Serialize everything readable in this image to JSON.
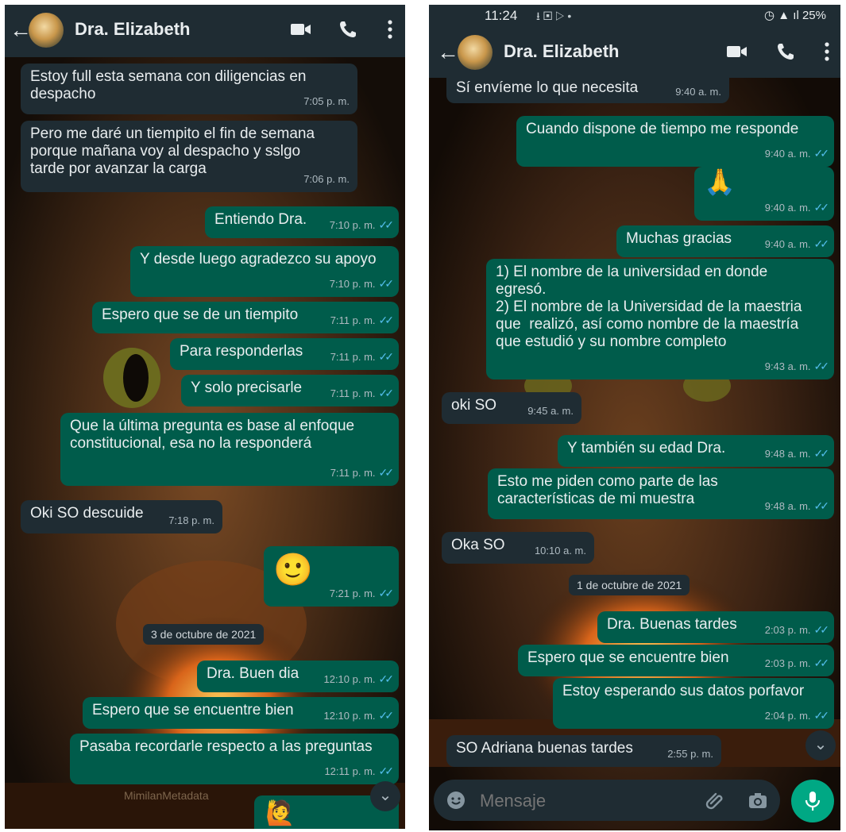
{
  "left": {
    "header": {
      "contact_name": "Dra. Elizabeth"
    },
    "messages": [
      {
        "dir": "in",
        "text": "Estoy full esta semana con diligencias en despacho",
        "time": "7:05 p. m."
      },
      {
        "dir": "in",
        "text": "Pero me daré un tiempito el fin de semana porque mañana voy al despacho y sslgo tarde por avanzar la carga",
        "time": "7:06 p. m."
      },
      {
        "dir": "out",
        "text": "Entiendo Dra.",
        "time": "7:10 p. m."
      },
      {
        "dir": "out",
        "text": "Y desde luego agradezco su apoyo",
        "time": "7:10 p. m."
      },
      {
        "dir": "out",
        "text": "Espero que se de un tiempito",
        "time": "7:11 p. m."
      },
      {
        "dir": "out",
        "text": "Para responderlas",
        "time": "7:11 p. m."
      },
      {
        "dir": "out",
        "text": "Y solo precisarle",
        "time": "7:11 p. m."
      },
      {
        "dir": "out",
        "text": "Que la última pregunta es base al enfoque constitucional, esa no la responderá",
        "time": "7:11 p. m."
      },
      {
        "dir": "in",
        "text": "Oki SO descuide",
        "time": "7:18 p. m."
      },
      {
        "dir": "out",
        "text": "🙂",
        "time": "7:21 p. m."
      },
      {
        "dir": "out",
        "text": "Dra. Buen dia",
        "time": "12:10 p. m."
      },
      {
        "dir": "out",
        "text": "Espero que se encuentre bien",
        "time": "12:10 p. m."
      },
      {
        "dir": "out",
        "text": "Pasaba recordarle respecto a las preguntas",
        "time": "12:11 p. m."
      },
      {
        "dir": "out",
        "text": "🙋",
        "time": ""
      }
    ],
    "date_chip": "3 de octubre de 2021",
    "watermark": "MimilanMetadata"
  },
  "right": {
    "status_bar": {
      "time": "11:24",
      "battery": "25%"
    },
    "header": {
      "contact_name": "Dra. Elizabeth"
    },
    "messages": [
      {
        "dir": "in",
        "text": "Sí envíeme lo que necesita",
        "time": "9:40 a. m."
      },
      {
        "dir": "out",
        "text": "Cuando dispone de tiempo me responde",
        "time": "9:40 a. m."
      },
      {
        "dir": "out",
        "text": "🙏",
        "time": "9:40 a. m."
      },
      {
        "dir": "out",
        "text": "Muchas gracias",
        "time": "9:40 a. m."
      },
      {
        "dir": "out",
        "text": "1) El nombre de la universidad en donde egresó.\n2) El nombre de la Universidad de la maestria que  realizó, así como nombre de la maestría que estudió y su nombre completo",
        "time": "9:43 a. m."
      },
      {
        "dir": "in",
        "text": "oki SO",
        "time": "9:45 a. m."
      },
      {
        "dir": "out",
        "text": "Y también su edad Dra.",
        "time": "9:48 a. m."
      },
      {
        "dir": "out",
        "text": "Esto me piden como parte de las características de mi muestra",
        "time": "9:48 a. m."
      },
      {
        "dir": "in",
        "text": "Oka SO",
        "time": "10:10 a. m."
      },
      {
        "dir": "out",
        "text": "Dra. Buenas tardes",
        "time": "2:03 p. m."
      },
      {
        "dir": "out",
        "text": "Espero que se encuentre bien",
        "time": "2:03 p. m."
      },
      {
        "dir": "out",
        "text": "Estoy esperando sus datos porfavor",
        "time": "2:04 p. m."
      },
      {
        "dir": "in",
        "text": "SO Adriana buenas tardes",
        "time": "2:55 p. m."
      }
    ],
    "date_chip": "1 de octubre de 2021",
    "input": {
      "placeholder": "Mensaje"
    }
  },
  "colors": {
    "header": "#1f2c33",
    "incoming_bubble": "#1f2c33",
    "outgoing_bubble": "#005c4b",
    "ticks_read": "#53bdeb",
    "mic_button": "#00a884"
  }
}
